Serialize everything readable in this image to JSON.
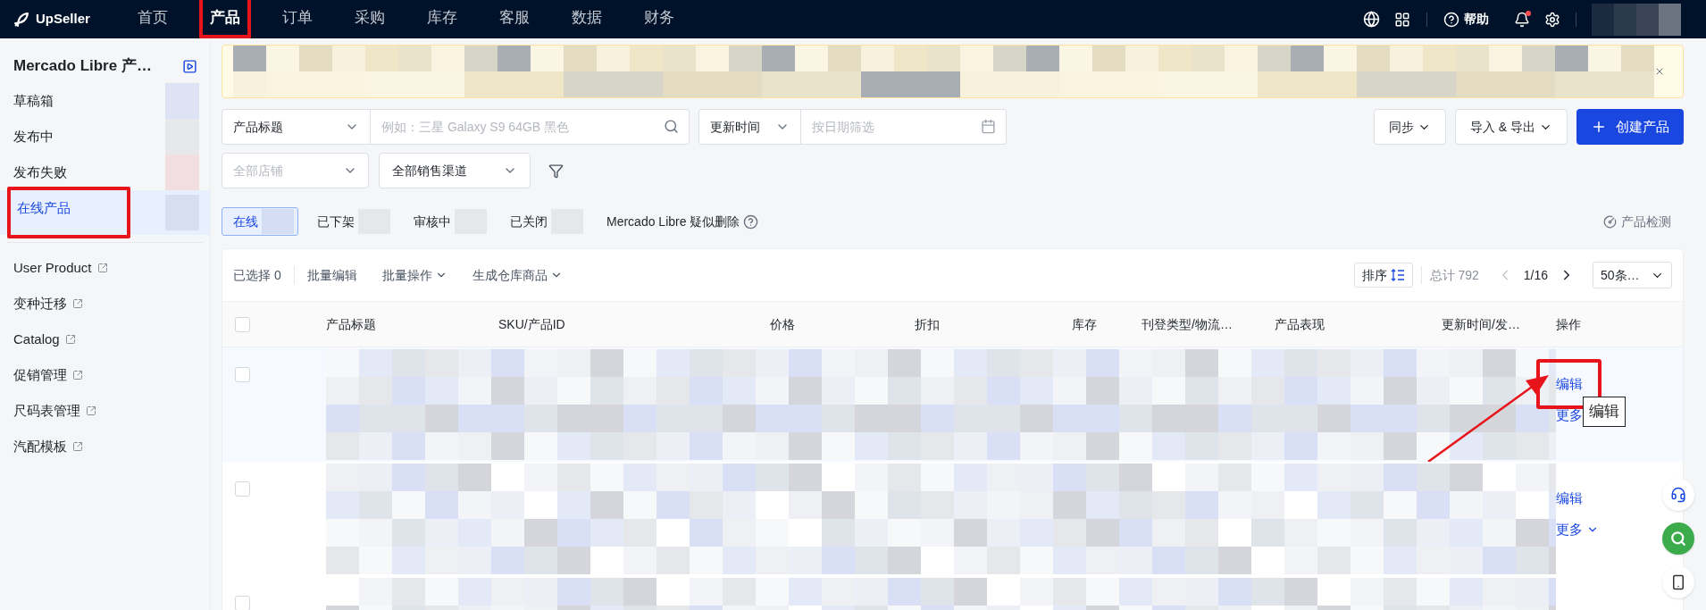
{
  "topbar": {
    "logo": "UpSeller",
    "nav": [
      {
        "label": "首页",
        "selected": false,
        "annotated": false
      },
      {
        "label": "产品",
        "selected": true,
        "annotated": true
      },
      {
        "label": "订单",
        "selected": false,
        "annotated": false
      },
      {
        "label": "采购",
        "selected": false,
        "annotated": false
      },
      {
        "label": "库存",
        "selected": false,
        "annotated": false
      },
      {
        "label": "客服",
        "selected": false,
        "annotated": false
      },
      {
        "label": "数据",
        "selected": false,
        "annotated": false
      },
      {
        "label": "财务",
        "selected": false,
        "annotated": false
      }
    ],
    "help": "帮助",
    "unread_notifications": true
  },
  "sidebar": {
    "title": "Mercado Libre 产…",
    "items": [
      {
        "label": "草稿箱",
        "selected": false,
        "external": false,
        "annotated": false
      },
      {
        "label": "发布中",
        "selected": false,
        "external": false,
        "annotated": false
      },
      {
        "label": "发布失败",
        "selected": false,
        "external": false,
        "annotated": false
      },
      {
        "label": "在线产品",
        "selected": true,
        "external": false,
        "annotated": true
      },
      {
        "label": "User Product",
        "selected": false,
        "external": true,
        "annotated": false
      },
      {
        "label": "变种迁移",
        "selected": false,
        "external": true,
        "annotated": false
      },
      {
        "label": "Catalog",
        "selected": false,
        "external": true,
        "annotated": false
      },
      {
        "label": "促销管理",
        "selected": false,
        "external": true,
        "annotated": false
      },
      {
        "label": "尺码表管理",
        "selected": false,
        "external": true,
        "annotated": false
      },
      {
        "label": "汽配模板",
        "selected": false,
        "external": true,
        "annotated": false
      }
    ]
  },
  "banner": {
    "dismissible": true
  },
  "filters": {
    "field_select": "产品标题",
    "search": {
      "placeholder": "例如：三星 Galaxy S9 64GB 黑色"
    },
    "date_select": "更新时间",
    "date": {
      "placeholder": "按日期筛选"
    },
    "store_select": {
      "placeholder": "全部店铺"
    },
    "channel_select": "全部销售渠道"
  },
  "actions": [
    {
      "label": "同步",
      "kind": "dropdown"
    },
    {
      "label": "导入 & 导出",
      "kind": "dropdown"
    },
    {
      "label": "创建产品",
      "kind": "primary"
    }
  ],
  "status_tabs": [
    {
      "label": "在线",
      "selected": true,
      "help": false
    },
    {
      "label": "已下架",
      "selected": false,
      "help": false
    },
    {
      "label": "审核中",
      "selected": false,
      "help": false
    },
    {
      "label": "已关闭",
      "selected": false,
      "help": false
    },
    {
      "label": "Mercado Libre 疑似删除",
      "selected": false,
      "help": true
    }
  ],
  "inspect_link": "产品检测",
  "toolbar": {
    "selected_count": "已选择 0",
    "bulk": [
      {
        "label": "批量编辑",
        "dropdown": false
      },
      {
        "label": "批量操作",
        "dropdown": true
      },
      {
        "label": "生成仓库商品",
        "dropdown": true
      }
    ],
    "sort": "排序",
    "total": "总计 792",
    "prev_disabled": true,
    "page": "1/16",
    "page_size": "50条…"
  },
  "table": {
    "header_checked": false,
    "columns": [
      "产品标题",
      "SKU/产品ID",
      "价格",
      "折扣",
      "库存",
      "刊登类型/物流…",
      "产品表现",
      "更新时间/发…",
      "操作"
    ],
    "rows": [
      {
        "checked": false,
        "hovered": true,
        "edit": "编辑",
        "more": "更多",
        "annotated": true,
        "tooltip": "编辑"
      },
      {
        "checked": false,
        "hovered": false,
        "edit": "编辑",
        "more": "更多",
        "annotated": false
      },
      {
        "checked": false,
        "hovered": false,
        "annotated": false
      }
    ]
  }
}
